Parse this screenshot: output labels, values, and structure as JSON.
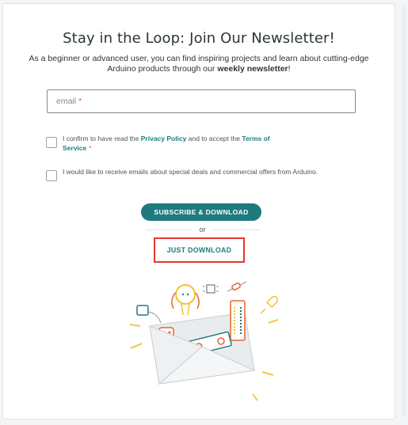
{
  "newsletter": {
    "title": "Stay in the Loop: Join Our Newsletter!",
    "subtitle_pre": "As a beginner or advanced user, you can find inspiring projects and learn about cutting-edge Arduino products through our ",
    "subtitle_bold": "weekly newsletter",
    "subtitle_post": "!"
  },
  "form": {
    "email_placeholder": "email",
    "required_mark": "*",
    "privacy": {
      "text_1": "I confirm to have read the ",
      "privacy_link": "Privacy Policy",
      "text_2": " and to accept the ",
      "terms_link": "Terms of Service"
    },
    "offers_text": "I would like to receive emails about special deals and commercial offers from Arduino."
  },
  "actions": {
    "subscribe_label": "SUBSCRIBE & DOWNLOAD",
    "or_label": "or",
    "download_label": "JUST DOWNLOAD"
  },
  "colors": {
    "accent": "#1f7a7e",
    "highlight_border": "#e8362c",
    "required": "#e4574b",
    "illustration_yellow": "#f2c230",
    "illustration_orange": "#e8642c"
  },
  "icons": [
    "envelope-illustration",
    "lightbulb-icon",
    "chip-icon",
    "resistor-icon",
    "led-icon",
    "board-icon",
    "robot-icon",
    "sensor-icon"
  ]
}
